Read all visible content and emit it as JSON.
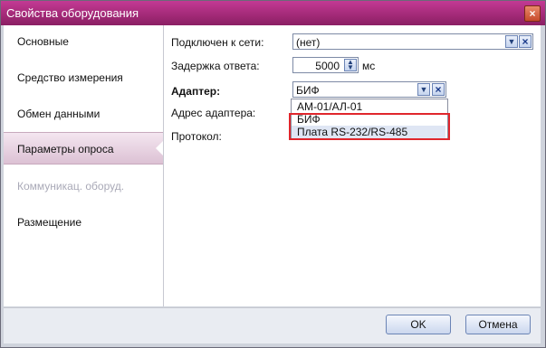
{
  "window": {
    "title": "Свойства оборудования"
  },
  "sidebar": {
    "items": [
      {
        "label": "Основные",
        "state": "normal"
      },
      {
        "label": "Средство измерения",
        "state": "normal"
      },
      {
        "label": "Обмен данными",
        "state": "normal"
      },
      {
        "label": "Параметры опроса",
        "state": "active"
      },
      {
        "label": "Коммуникац. оборуд.",
        "state": "disabled"
      },
      {
        "label": "Размещение",
        "state": "normal"
      }
    ]
  },
  "form": {
    "network": {
      "label": "Подключен к сети:",
      "value": "(нет)"
    },
    "delay": {
      "label": "Задержка ответа:",
      "value": "5000",
      "unit": "мс"
    },
    "adapter": {
      "label": "Адаптер:",
      "value": "БИФ",
      "options": [
        "АМ-01/АЛ-01",
        "БИФ",
        "Плата RS-232/RS-485"
      ],
      "highlighted_option": "Плата RS-232/RS-485"
    },
    "adapter_address": {
      "label": "Адрес адаптера:"
    },
    "protocol": {
      "label": "Протокол:"
    }
  },
  "footer": {
    "ok_label": "OK",
    "cancel_label": "Отмена"
  },
  "colors": {
    "titlebar": "#b0307e",
    "annotation_frame": "#e0262c"
  }
}
